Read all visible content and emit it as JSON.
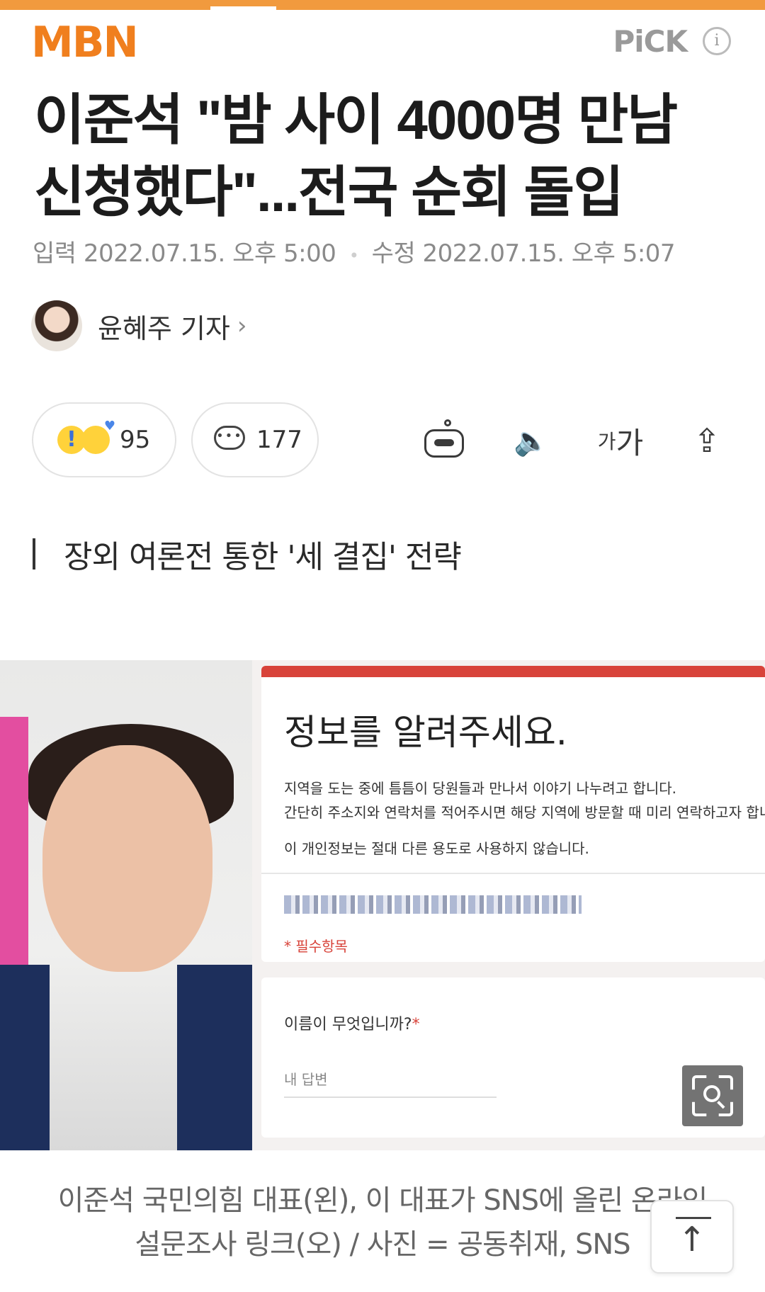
{
  "header": {
    "logo": "MBN",
    "pick_label": "PiCK",
    "info_icon": "i"
  },
  "article": {
    "title": "이준석 \"밤 사이 4000명 만남 신청했다\"...전국 순회 돌입",
    "dates": {
      "input_label": "입력",
      "input_value": "2022.07.15. 오후 5:00",
      "edit_label": "수정",
      "edit_value": "2022.07.15. 오후 5:07"
    },
    "reporter": {
      "name": "윤혜주 기자",
      "chevron": "›"
    },
    "reactions": {
      "count": "95"
    },
    "comments": {
      "count": "177"
    },
    "toolbar": {
      "robot_icon": "robot-icon",
      "speaker": "🔈",
      "font_small": "가",
      "font_large": "가",
      "share": "⇪"
    },
    "subheading": "장외 여론전 통한 '세 결집' 전략",
    "caption": "이준석 국민의힘 대표(왼), 이 대표가 SNS에 올린 온라인 설문조사 링크(오) / 사진 = 공동취재, SNS"
  },
  "form": {
    "title": "정보를 알려주세요.",
    "desc_line1": "지역을 도는 중에 틈틈이 당원들과 만나서 이야기 나누려고 합니다.",
    "desc_line2": "간단히 주소지와 연락처를 적어주시면 해당 지역에 방문할 때 미리 연락하고자 합니다.",
    "privacy": "이 개인정보는 절대 다른 용도로 사용하지 않습니다.",
    "required": "* 필수항목",
    "question": "이름이 무엇입니까?",
    "question_star": "*",
    "answer_placeholder": "내 답변"
  },
  "colors": {
    "brand_orange": "#f07f1e",
    "top_bar": "#f19a3e",
    "form_red": "#d8433a"
  }
}
